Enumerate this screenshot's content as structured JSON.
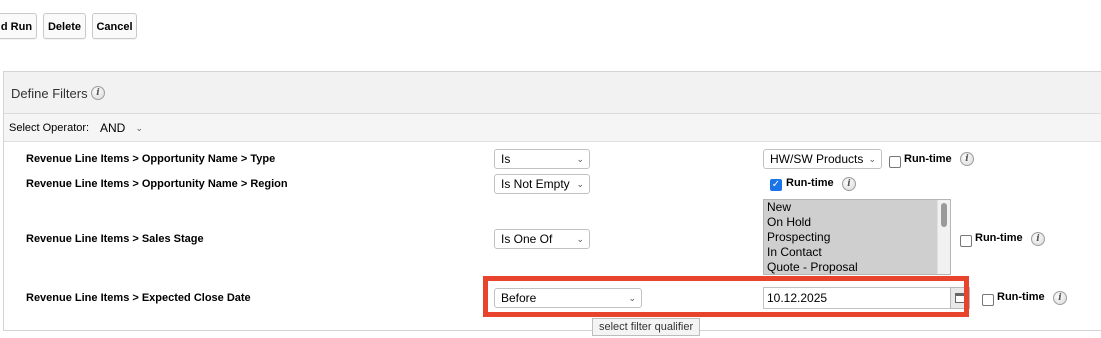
{
  "toolbar": {
    "save_run_label": "d Run",
    "delete_label": "Delete",
    "cancel_label": "Cancel"
  },
  "filters": {
    "title": "Define Filters",
    "operator_label": "Select Operator:",
    "operator_value": "AND",
    "rows": [
      {
        "field": "Revenue Line Items > Opportunity Name > Type",
        "qualifier": "Is",
        "value": "HW/SW Products",
        "runtime_label": "Run-time",
        "runtime_checked": false
      },
      {
        "field": "Revenue Line Items > Opportunity Name > Region",
        "qualifier": "Is Not Empty",
        "runtime_label": "Run-time",
        "runtime_checked": true
      },
      {
        "field": "Revenue Line Items > Sales Stage",
        "qualifier": "Is One Of",
        "options": [
          "New",
          "On Hold",
          "Prospecting",
          "In Contact",
          "Quote - Proposal"
        ],
        "runtime_label": "Run-time",
        "runtime_checked": false
      },
      {
        "field": "Revenue Line Items > Expected Close Date",
        "qualifier": "Before",
        "value": "10.12.2025",
        "runtime_label": "Run-time",
        "runtime_checked": false
      }
    ]
  },
  "tooltip": "select filter qualifier",
  "icons": {
    "info": "info-icon",
    "chevron": "chevron-down-icon",
    "calendar": "calendar-icon",
    "check": "checkmark-icon"
  },
  "colors": {
    "highlight": "#e8432c",
    "checkbox_checked": "#1a73e8",
    "selected_option_bg": "#cfcfcf"
  }
}
